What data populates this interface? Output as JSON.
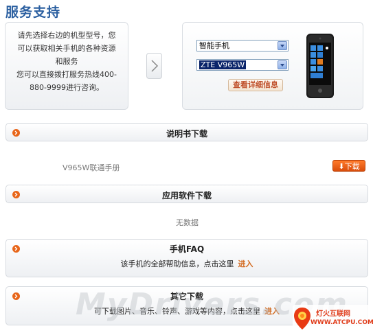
{
  "page_title": "服务支持",
  "info": {
    "line1": "请先选择右边的机型型号，您",
    "line2": "可以获取相关手机的各种资源",
    "line3": "和服务",
    "line4": "您可以直接拨打服务热线400-",
    "line5": "880-9999进行咨询。"
  },
  "selector": {
    "category_value": "智能手机",
    "model_value": "ZTE V965W",
    "detail_button": "查看详细信息"
  },
  "sections": {
    "manual": {
      "title": "说明书下载",
      "item": "V965W联通手册",
      "download_button": "下载"
    },
    "apps": {
      "title": "应用软件下载",
      "empty": "无数据"
    },
    "faq": {
      "title": "手机FAQ",
      "desc": "该手机的全部帮助信息，点击这里",
      "link": "进入"
    },
    "other": {
      "title": "其它下载",
      "desc": "可下载图片、音乐、铃声、游戏等内容，点击这里",
      "link": "进入"
    }
  },
  "watermark": "MyDrivers.com",
  "logo": {
    "name": "灯火互联网",
    "url": "WWW.ATCPU.COM"
  },
  "colors": {
    "title": "#2b5fa0",
    "accent": "#d2691e",
    "icon_orange": "#e8661a"
  }
}
